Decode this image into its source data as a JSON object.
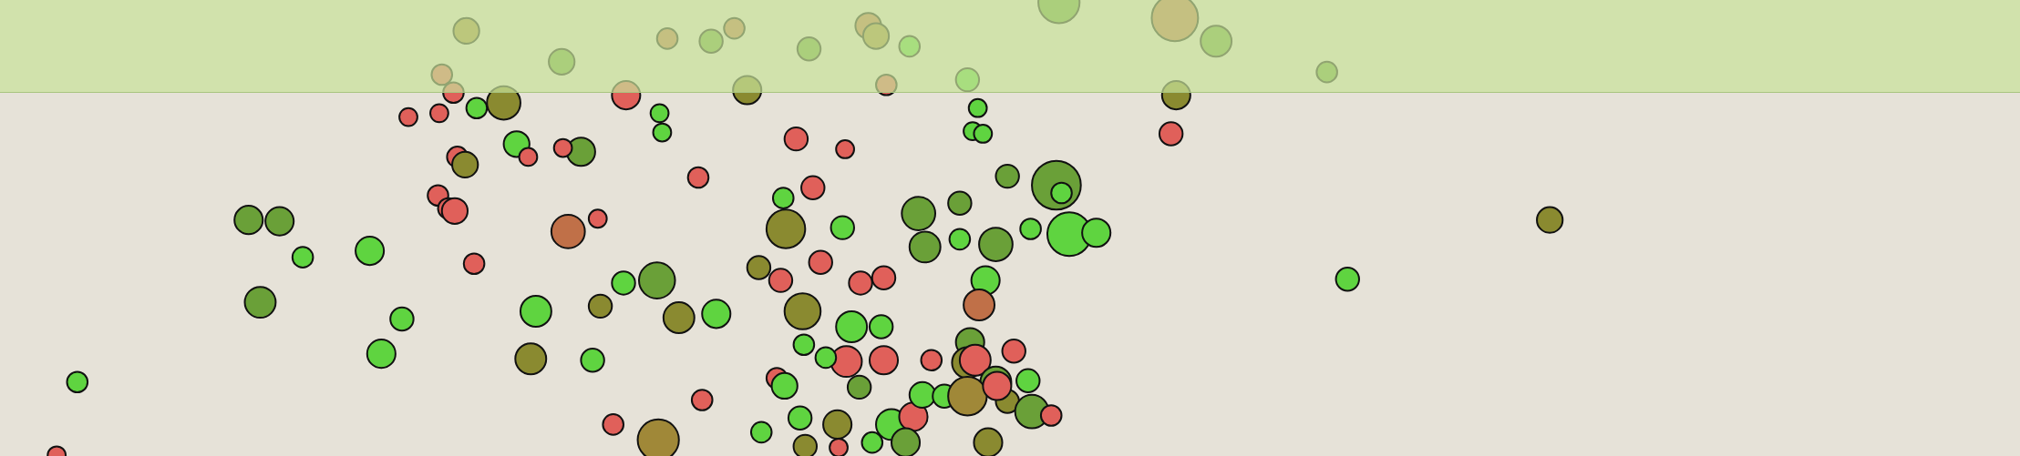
{
  "map": {
    "shown": true
  },
  "markers": {
    "shown": true
  },
  "top_bar": {
    "shown": true
  }
}
